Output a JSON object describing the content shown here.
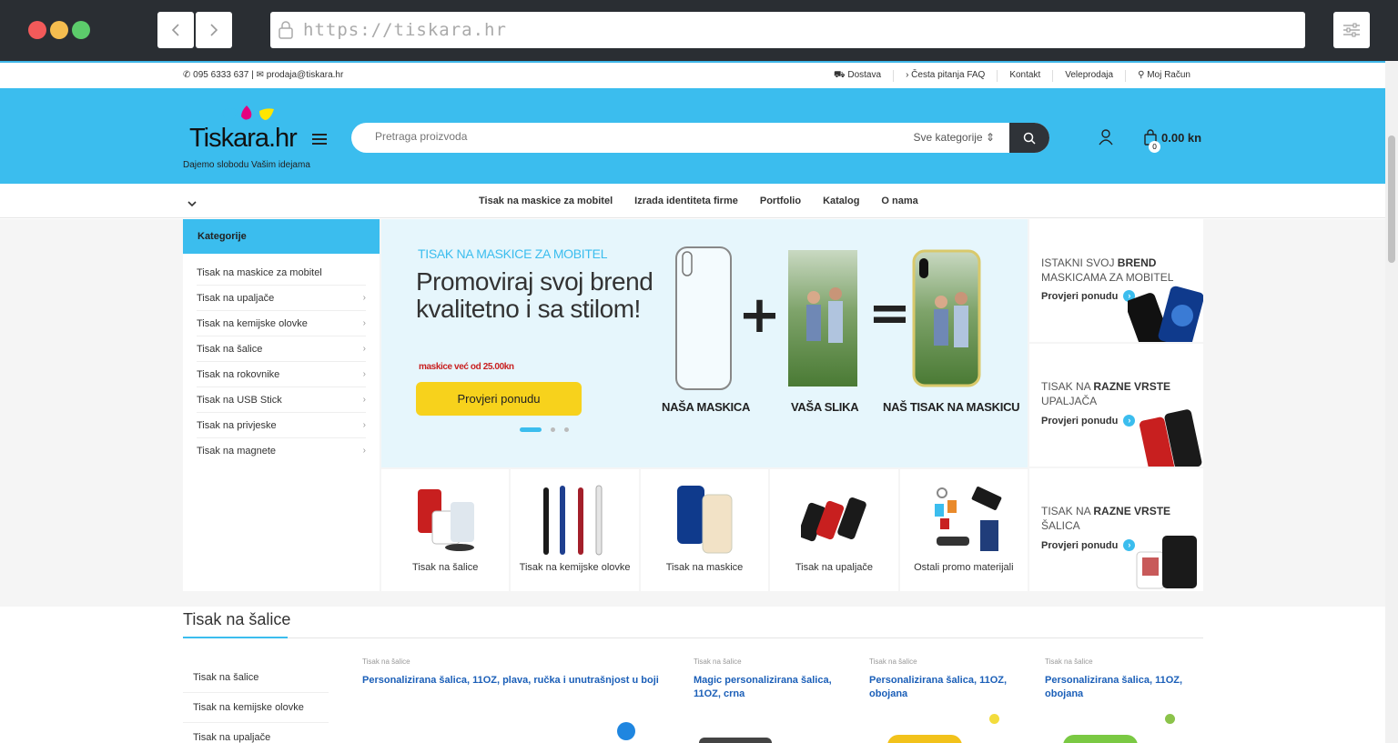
{
  "browser": {
    "url": "https://tiskara.hr"
  },
  "topbar": {
    "phone": "095 6333 637",
    "email": "prodaja@tiskara.hr",
    "links": [
      "Dostava",
      "Česta pitanja FAQ",
      "Kontakt",
      "Veleprodaja",
      "Moj Račun"
    ]
  },
  "header": {
    "logo_text": "Tiskara.hr",
    "logo_tagline": "Dajemo slobodu Vašim idejama",
    "search_placeholder": "Pretraga proizvoda",
    "category_select": "Sve kategorije",
    "cart_total": "0.00 kn",
    "cart_count": "0"
  },
  "nav": {
    "items": [
      "Tisak na maskice za mobitel",
      "Izrada identiteta firme",
      "Portfolio",
      "Katalog",
      "O nama"
    ]
  },
  "sidebar": {
    "title": "Kategorije",
    "items": [
      "Tisak na maskice za mobitel",
      "Tisak na upaljače",
      "Tisak na kemijske olovke",
      "Tisak na šalice",
      "Tisak na rokovnike",
      "Tisak na USB Stick",
      "Tisak na privjeske",
      "Tisak na magnete"
    ]
  },
  "hero": {
    "kicker": "TISAK NA MASKICE ZA MOBITEL",
    "title": "Promoviraj svoj brend kvalitetno i sa stilom!",
    "promo": "maskice već od 25.00kn",
    "cta": "Provjeri ponudu",
    "captions": [
      "NAŠA MASKICA",
      "VAŠA SLIKA",
      "NAŠ TISAK NA MASKICU"
    ]
  },
  "side_cards": [
    {
      "pre": "ISTAKNI SVOJ ",
      "bold": "BREND",
      "post": "MASKICAMA ZA MOBITEL",
      "link": "Provjeri ponudu"
    },
    {
      "pre": "TISAK NA ",
      "bold": "RAZNE VRSTE",
      "post": "UPALJAČA",
      "link": "Provjeri ponudu"
    },
    {
      "pre": "TISAK NA ",
      "bold": "RAZNE VRSTE",
      "post": "ŠALICA",
      "link": "Provjeri ponudu"
    }
  ],
  "tiles": [
    "Tisak na šalice",
    "Tisak na kemijske olovke",
    "Tisak na maskice",
    "Tisak na upaljače",
    "Ostali promo materijali"
  ],
  "section": {
    "title": "Tisak na šalice",
    "sublinks": [
      "Tisak na šalice",
      "Tisak na kemijske olovke",
      "Tisak na upaljače"
    ],
    "products": [
      {
        "category": "Tisak na šalice",
        "name": "Personalizirana šalica, 11OZ, plava, ručka i unutrašnjost u boji"
      },
      {
        "category": "Tisak na šalice",
        "name": "Magic personalizirana šalica, 11OZ, crna"
      },
      {
        "category": "Tisak na šalice",
        "name": "Personalizirana šalica, 11OZ, obojana"
      },
      {
        "category": "Tisak na šalice",
        "name": "Personalizirana šalica, 11OZ, obojana"
      }
    ]
  },
  "colors": {
    "brand_blue": "#3bbdee",
    "cta_yellow": "#f7d21c",
    "promo_red": "#c81f1f",
    "product_link": "#1b5fb8"
  }
}
